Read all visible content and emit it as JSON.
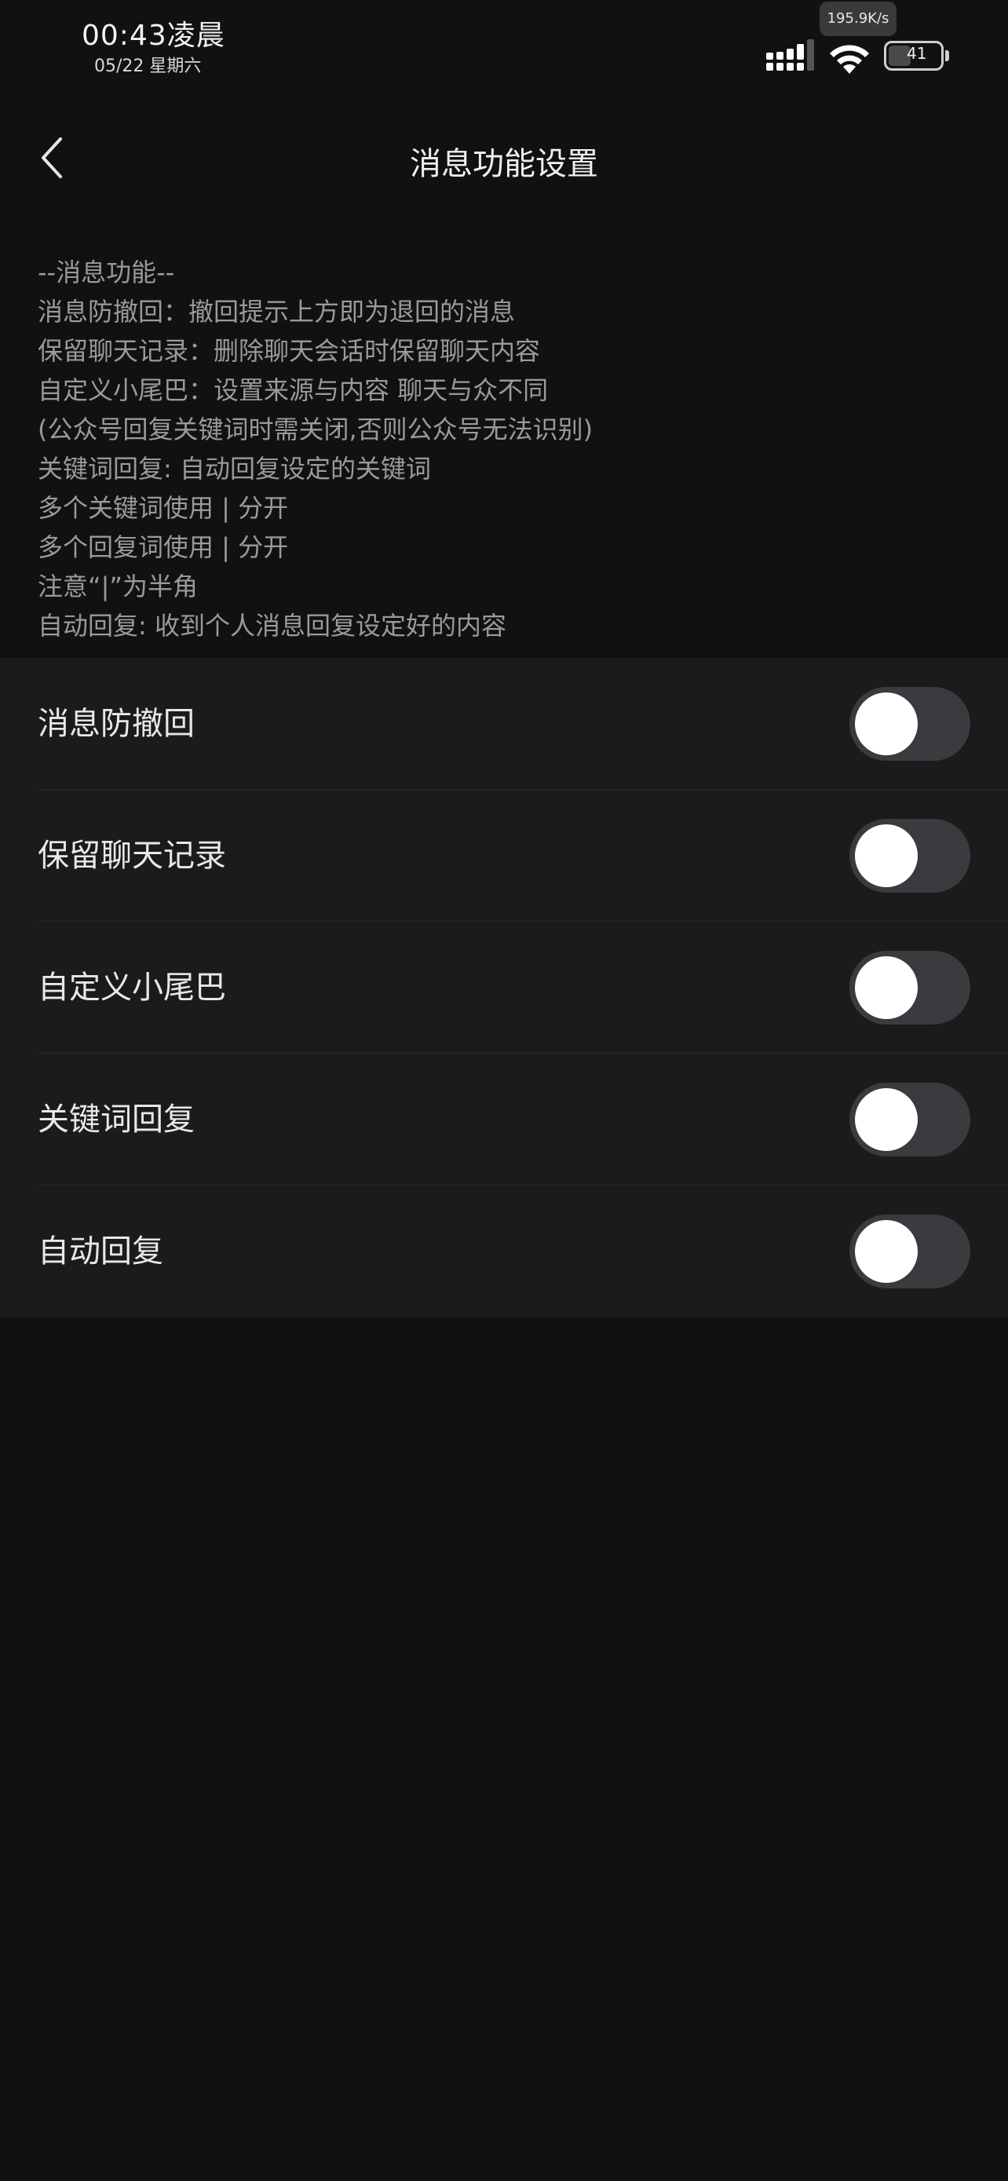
{
  "status_bar": {
    "time": "00:43凌晨",
    "date": "05/22 星期六",
    "net_speed": "195.9K/s",
    "battery": "41",
    "icons": [
      "signal-icon",
      "wifi-icon",
      "battery-icon"
    ]
  },
  "header": {
    "title": "消息功能设置",
    "back_icon": "chevron-left-icon"
  },
  "description": [
    "--消息功能--",
    "消息防撤回：撤回提示上方即为退回的消息",
    "保留聊天记录：删除聊天会话时保留聊天内容",
    "自定义小尾巴：设置来源与内容 聊天与众不同",
    "(公众号回复关键词时需关闭,否则公众号无法识别)",
    "关键词回复: 自动回复设定的关键词",
    "多个关键词使用 | 分开",
    "多个回复词使用 | 分开",
    "注意“|”为半角",
    "自动回复: 收到个人消息回复设定好的内容"
  ],
  "settings": [
    {
      "label": "消息防撤回",
      "enabled": false
    },
    {
      "label": "保留聊天记录",
      "enabled": false
    },
    {
      "label": "自定义小尾巴",
      "enabled": false
    },
    {
      "label": "关键词回复",
      "enabled": false
    },
    {
      "label": "自动回复",
      "enabled": false
    }
  ],
  "colors": {
    "background": "#111111",
    "list_background": "#1b1b1b",
    "toggle_off_track": "#3a3a3f",
    "toggle_knob": "#ffffff",
    "description_text": "#9a9a9a"
  }
}
